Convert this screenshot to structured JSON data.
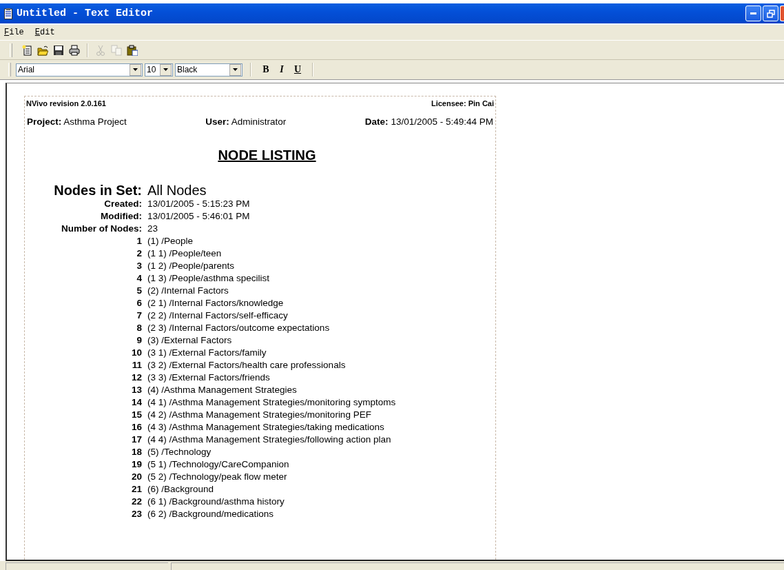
{
  "window": {
    "title": "Untitled - Text Editor"
  },
  "menu": [
    {
      "label": "File"
    },
    {
      "label": "Edit"
    }
  ],
  "toolbar": [
    {
      "kind": "new",
      "disabled": false
    },
    {
      "kind": "open",
      "disabled": false
    },
    {
      "kind": "save",
      "disabled": false
    },
    {
      "kind": "print",
      "disabled": false
    },
    {
      "kind": "separator"
    },
    {
      "kind": "cut",
      "disabled": true
    },
    {
      "kind": "copy",
      "disabled": true
    },
    {
      "kind": "paste",
      "disabled": false
    }
  ],
  "format_bar": {
    "font": "Arial",
    "size": "10",
    "color_name": "Black",
    "styles": [
      {
        "kind": "bold",
        "label": "B"
      },
      {
        "kind": "italic",
        "label": "I"
      },
      {
        "kind": "underline",
        "label": "U"
      }
    ]
  },
  "document": {
    "header_left": "NVivo revision 2.0.161",
    "header_right": "Licensee: Pin Cai",
    "info": [
      {
        "label": "Project:",
        "value": "Asthma Project"
      },
      {
        "label": "User:",
        "value": "Administrator"
      },
      {
        "label": "Date:",
        "value": "13/01/2005 - 5:49:44 PM"
      }
    ],
    "heading": "NODE LISTING",
    "set": {
      "label": "Nodes in Set:",
      "value": "All Nodes"
    },
    "meta": [
      {
        "label": "Created:",
        "value": "13/01/2005 - 5:15:23 PM"
      },
      {
        "label": "Modified:",
        "value": "13/01/2005 - 5:46:01 PM"
      },
      {
        "label": "Number of Nodes:",
        "value": "23"
      }
    ],
    "nodes": [
      {
        "number": "1",
        "text": "(1) /People"
      },
      {
        "number": "2",
        "text": "(1 1) /People/teen"
      },
      {
        "number": "3",
        "text": "(1 2) /People/parents"
      },
      {
        "number": "4",
        "text": "(1 3) /People/asthma specilist"
      },
      {
        "number": "5",
        "text": "(2) /Internal Factors"
      },
      {
        "number": "6",
        "text": "(2 1) /Internal Factors/knowledge"
      },
      {
        "number": "7",
        "text": "(2 2) /Internal Factors/self-efficacy"
      },
      {
        "number": "8",
        "text": "(2 3) /Internal Factors/outcome expectations"
      },
      {
        "number": "9",
        "text": "(3) /External Factors"
      },
      {
        "number": "10",
        "text": "(3 1) /External Factors/family"
      },
      {
        "number": "11",
        "text": "(3 2) /External Factors/health care professionals"
      },
      {
        "number": "12",
        "text": "(3 3) /External Factors/friends"
      },
      {
        "number": "13",
        "text": "(4) /Asthma Management Strategies"
      },
      {
        "number": "14",
        "text": "(4 1) /Asthma Management Strategies/monitoring symptoms"
      },
      {
        "number": "15",
        "text": "(4 2) /Asthma Management Strategies/monitoring PEF"
      },
      {
        "number": "16",
        "text": "(4 3) /Asthma Management Strategies/taking medications"
      },
      {
        "number": "17",
        "text": "(4 4) /Asthma Management Strategies/following action plan"
      },
      {
        "number": "18",
        "text": "(5) /Technology"
      },
      {
        "number": "19",
        "text": "(5 1) /Technology/CareCompanion"
      },
      {
        "number": "20",
        "text": "(5 2) /Technology/peak flow meter"
      },
      {
        "number": "21",
        "text": "(6) /Background"
      },
      {
        "number": "22",
        "text": "(6 1) /Background/asthma history"
      },
      {
        "number": "23",
        "text": "(6 2) /Background/medications"
      }
    ]
  }
}
